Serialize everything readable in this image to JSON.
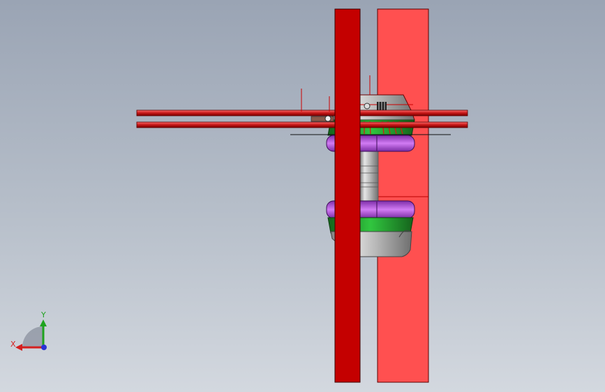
{
  "viewport": {
    "background_top": "#9aa4b4",
    "background_bottom": "#d3d8df"
  },
  "triad": {
    "x_label": "X",
    "y_label": "Y",
    "x_color": "#d41f1f",
    "y_color": "#1fa31f",
    "z_color": "#2a33d4"
  },
  "model": {
    "parts": [
      {
        "name": "left-column",
        "color": "#c40000"
      },
      {
        "name": "right-column",
        "color": "#ff5050"
      },
      {
        "name": "horizontal-beams",
        "color": "#c81a1a"
      },
      {
        "name": "upper-housing",
        "color": "#c9c9c9"
      },
      {
        "name": "upper-green-band",
        "color": "#1f9c2b"
      },
      {
        "name": "purple-rings",
        "color": "#b24ad8"
      },
      {
        "name": "shaft",
        "color": "#bdbdbd"
      },
      {
        "name": "lower-green-band",
        "color": "#1f9c2b"
      },
      {
        "name": "lower-housing",
        "color": "#c8c8c8"
      }
    ]
  }
}
